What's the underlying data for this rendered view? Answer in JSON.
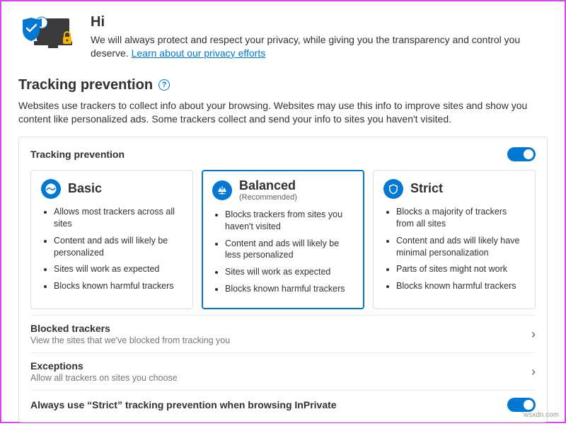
{
  "hero": {
    "greeting": "Hi",
    "body": "We will always protect and respect your privacy, while giving you the transparency and control you deserve. ",
    "link": "Learn about our privacy efforts"
  },
  "section": {
    "title": "Tracking prevention",
    "help_glyph": "?",
    "desc": "Websites use trackers to collect info about your browsing. Websites may use this info to improve sites and show you content like personalized ads. Some trackers collect and send your info to sites you haven't visited."
  },
  "panel": {
    "title": "Tracking prevention",
    "toggle_on": true
  },
  "cards": [
    {
      "name": "basic",
      "title": "Basic",
      "subtitle": "",
      "selected": false,
      "bullets": [
        "Allows most trackers across all sites",
        "Content and ads will likely be personalized",
        "Sites will work as expected",
        "Blocks known harmful trackers"
      ]
    },
    {
      "name": "balanced",
      "title": "Balanced",
      "subtitle": "(Recommended)",
      "selected": true,
      "bullets": [
        "Blocks trackers from sites you haven't visited",
        "Content and ads will likely be less personalized",
        "Sites will work as expected",
        "Blocks known harmful trackers"
      ]
    },
    {
      "name": "strict",
      "title": "Strict",
      "subtitle": "",
      "selected": false,
      "bullets": [
        "Blocks a majority of trackers from all sites",
        "Content and ads will likely have minimal personalization",
        "Parts of sites might not work",
        "Blocks known harmful trackers"
      ]
    }
  ],
  "rows": {
    "blocked": {
      "title": "Blocked trackers",
      "sub": "View the sites that we've blocked from tracking you"
    },
    "exceptions": {
      "title": "Exceptions",
      "sub": "Allow all trackers on sites you choose"
    },
    "inprivate": {
      "title": "Always use “Strict” tracking prevention when browsing InPrivate"
    }
  },
  "watermark": "wsxdn.com"
}
